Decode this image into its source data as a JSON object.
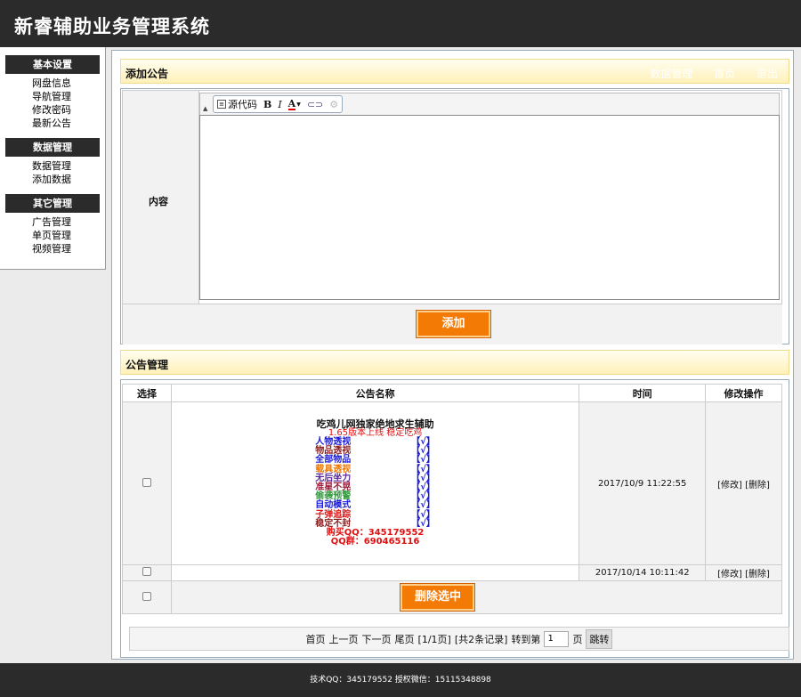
{
  "app": {
    "title": "新睿辅助业务管理系统"
  },
  "sidebar": {
    "groups": [
      {
        "title": "基本设置",
        "items": [
          "网盘信息",
          "导航管理",
          "修改密码",
          "最新公告"
        ]
      },
      {
        "title": "数据管理",
        "items": [
          "数据管理",
          "添加数据"
        ]
      },
      {
        "title": "其它管理",
        "items": [
          "广告管理",
          "单页管理",
          "视频管理"
        ]
      }
    ]
  },
  "add_notice": {
    "header": "添加公告",
    "header_links": [
      "数据管理",
      "首页",
      "退出"
    ],
    "content_label": "内容",
    "toolbar": {
      "source_label": "源代码",
      "bold": "B",
      "italic": "I",
      "font_color": "A"
    },
    "add_button": "添加"
  },
  "notice_manage": {
    "header": "公告管理",
    "columns": [
      "选择",
      "公告名称",
      "时间",
      "修改操作"
    ],
    "rows": [
      {
        "notice": {
          "title": "吃鸡儿网独家绝地求生辅助",
          "subtitle": "1.65版本上线 稳定吃鸡",
          "features": [
            {
              "name": "人物透视",
              "mark": "【√】",
              "color": "#1a1ad8"
            },
            {
              "name": "物品透视",
              "mark": "【√】",
              "color": "#8b1f1f"
            },
            {
              "name": "全部物品",
              "mark": "【√】",
              "color": "#1a1ad8"
            },
            {
              "name": "载具透视",
              "mark": "【√】",
              "color": "#f07800"
            },
            {
              "name": "无后坐力",
              "mark": "【√】",
              "color": "#5a2a9a"
            },
            {
              "name": "准星不晃",
              "mark": "【√】",
              "color": "#9a1a3a"
            },
            {
              "name": "偷袭预警",
              "mark": "【√】",
              "color": "#2e9a3a"
            },
            {
              "name": "自动模式",
              "mark": "【√】",
              "color": "#1a1ad8"
            },
            {
              "name": "子弹追踪",
              "mark": "【√】",
              "color": "#d81a1a"
            },
            {
              "name": "稳定不封",
              "mark": "【√】",
              "color": "#8b1f1f"
            }
          ],
          "buy_qq": "购买QQ：345179552",
          "qq_group": "QQ群：690465116"
        },
        "time": "2017/10/9 11:22:55",
        "edit": "[修改]",
        "delete": "[删除]"
      },
      {
        "notice": null,
        "time": "2017/10/14 10:11:42",
        "edit": "[修改]",
        "delete": "[删除]"
      }
    ],
    "delete_selected_button": "删除选中"
  },
  "pager": {
    "first": "首页",
    "prev": "上一页",
    "next": "下一页",
    "last": "尾页",
    "page_info": "[1/1页]",
    "record_info": "[共2条记录]",
    "goto_label": "转到第",
    "page_value": "1",
    "page_unit": "页",
    "jump_button": "跳转"
  },
  "footer": {
    "text": "技术QQ：345179552 授权微信：15115348898"
  },
  "colors": {
    "dark": "#2b2b2b",
    "accent_orange": "#f47a06",
    "header_yellow": "#fff1b8"
  }
}
